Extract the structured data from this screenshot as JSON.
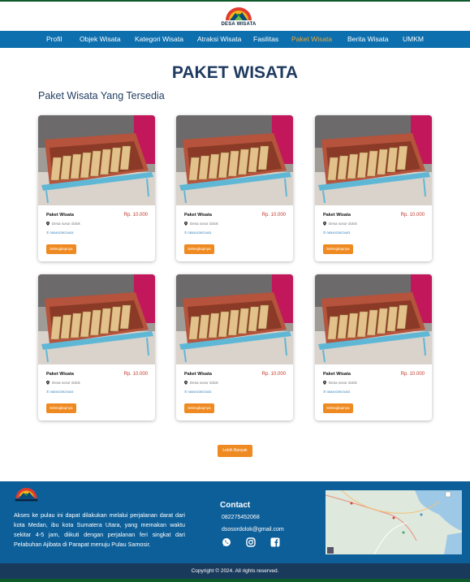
{
  "site": {
    "logo_text": "DESA WISATA"
  },
  "nav": {
    "items": [
      {
        "label": "Profil",
        "active": false
      },
      {
        "label": "Objek Wisata",
        "active": false
      },
      {
        "label": "Kategori Wisata",
        "active": false
      },
      {
        "label": "Atraksi Wisata",
        "active": false
      },
      {
        "label": "Fasilitas",
        "active": false
      },
      {
        "label": "Paket Wisata",
        "active": true
      },
      {
        "label": "Berita Wisata",
        "active": false
      },
      {
        "label": "UMKM",
        "active": false
      }
    ]
  },
  "main": {
    "page_title": "PAKET WISATA",
    "section_title": "Paket Wisata Yang Tersedia",
    "cards": [
      {
        "name": "Paket Wisata",
        "price": "Rp. 10.000",
        "location": "Desa sosor dolok",
        "phone": "0834923923403",
        "button": "Selengkapnya"
      },
      {
        "name": "Paket Wisata",
        "price": "Rp. 10.000",
        "location": "Desa sosor dolok",
        "phone": "0834923923403",
        "button": "Selengkapnya"
      },
      {
        "name": "Paket Wisata",
        "price": "Rp. 10.000",
        "location": "Desa sosor dolok",
        "phone": "0834923923403",
        "button": "Selengkapnya"
      },
      {
        "name": "Paket Wisata",
        "price": "Rp. 10.000",
        "location": "Desa sosor dolok",
        "phone": "0834923923403",
        "button": "Selengkapnya"
      },
      {
        "name": "Paket Wisata",
        "price": "Rp. 10.000",
        "location": "Desa sosor dolok",
        "phone": "0834923923403",
        "button": "Selengkapnya"
      },
      {
        "name": "Paket Wisata",
        "price": "Rp. 10.000",
        "location": "Desa sosor dolok",
        "phone": "0834923923403",
        "button": "Selengkapnya"
      }
    ],
    "more_button": "Lebih Banyak"
  },
  "footer": {
    "description": "Akses ke pulau ini dapat dilakukan melalui perjalanan darat dari kota Medan, ibu kota Sumatera Utara, yang memakan waktu sekitar 4-5 jam, diikuti dengan perjalanan feri singkat dari Pelabuhan Ajibata di Parapat menuju Pulau Samosir.",
    "contact_title": "Contact",
    "phone": "082275452068",
    "email": "dsosordolok@gmail.com",
    "social_icons": [
      "whatsapp-icon",
      "instagram-icon",
      "facebook-icon"
    ],
    "copyright": "Copyright © 2024. All rights reserved."
  },
  "colors": {
    "nav_bg": "#0d6fae",
    "active_nav": "#f4a72b",
    "accent_button": "#ef8a22",
    "price": "#c0392b",
    "title": "#1e3a5f",
    "footer_bg": "#0d5f99",
    "copyright_bg": "#1a3a5c"
  }
}
